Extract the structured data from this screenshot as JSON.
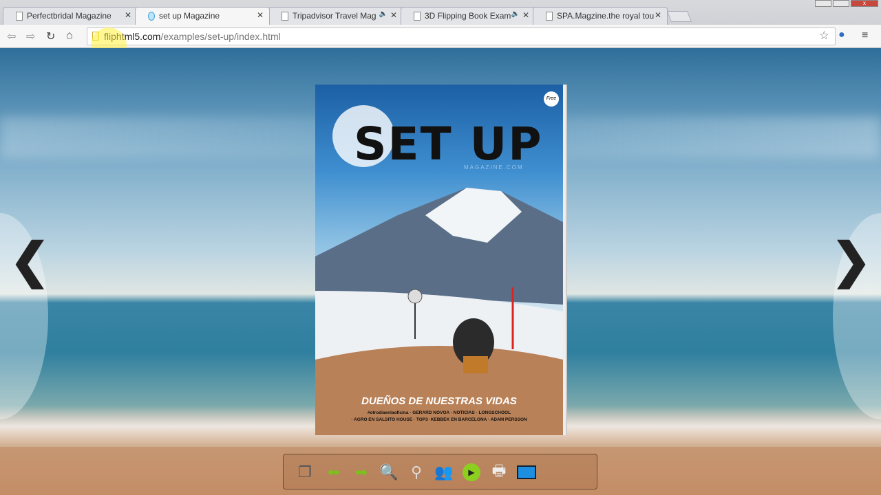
{
  "browser": {
    "tabs": [
      {
        "label": "Perfectbridal Magazine",
        "audio": false
      },
      {
        "label": "set up Magazine",
        "audio": false,
        "active": true
      },
      {
        "label": "Tripadvisor Travel Mag",
        "audio": true
      },
      {
        "label": "3D Flipping Book Exam",
        "audio": true
      },
      {
        "label": "SPA.Magzine.the royal tou",
        "audio": false
      }
    ],
    "url_domain": "fliphtml5.com",
    "url_path": "/examples/set-up/index.html"
  },
  "cover": {
    "title": "SET UP",
    "subtitle": "MAGAZINE.COM",
    "badge": "Free",
    "headline": "DUEÑOS DE NUESTRAS VIDAS",
    "credits_line1": "#otrodiaenlaoficina · GERARD NOVOA · NOTICIAS · LONGSCHOOL",
    "credits_line2": "· AGRO EN SALSITO HOUSE · TOP3 ·KEBBEK EN BARCELONA · ADAM PERSSON"
  },
  "nav": {
    "prev": "❮",
    "next": "❯"
  },
  "icons": [
    "thumbnails-icon",
    "prev-page-icon",
    "next-page-icon",
    "zoom-in-icon",
    "search-icon",
    "share-icon",
    "autoplay-icon",
    "print-icon",
    "fullscreen-icon"
  ]
}
